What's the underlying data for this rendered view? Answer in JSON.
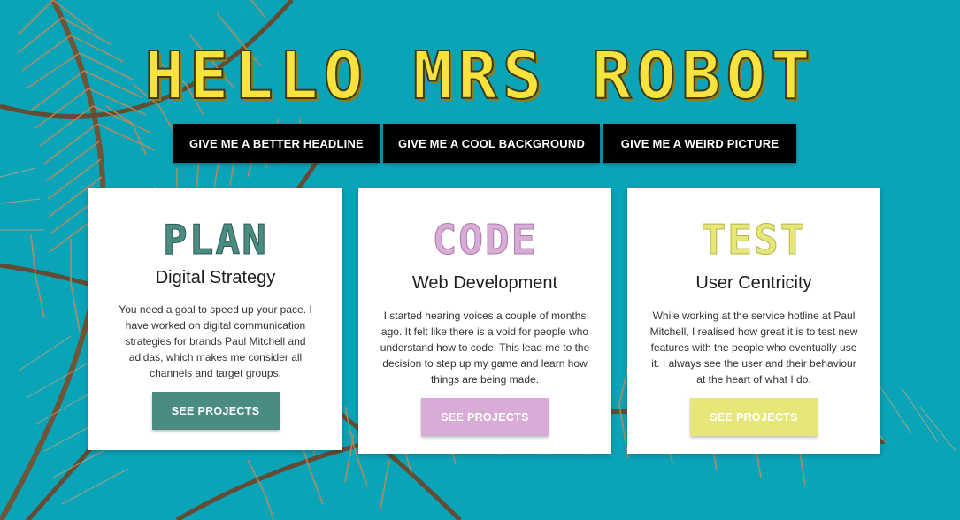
{
  "hero": {
    "title": "HELLO MRS ROBOT"
  },
  "actions": [
    {
      "label": "GIVE ME A BETTER HEADLINE"
    },
    {
      "label": "GIVE ME A COOL BACKGROUND"
    },
    {
      "label": "GIVE ME A WEIRD PICTURE"
    }
  ],
  "cards": [
    {
      "tag": "PLAN",
      "title": "Digital Strategy",
      "text": "You need a goal to speed up your pace. I have worked on digital communication strategies for brands Paul Mitchell and adidas, which makes me consider all channels and target groups.",
      "button": "SEE PROJECTS",
      "color": "#4a8c82",
      "tag_color": "#4a8c82"
    },
    {
      "tag": "CODE",
      "title": "Web Development",
      "text": "I started hearing voices a couple of months ago. It felt like there is a void for people who understand how to code. This lead me to the decision to step up my game and learn how things are being made.",
      "button": "SEE PROJECTS",
      "color": "#d9acd8",
      "tag_color": "#d9acd8"
    },
    {
      "tag": "TEST",
      "title": "User Centricity",
      "text": "While working at the service hotline at Paul Mitchell, I realised how great it is to test new features with the people who eventually use it. I always see the user and their behaviour at the heart of what I do.",
      "button": "SEE PROJECTS",
      "color": "#e6e679",
      "tag_color": "#e6e679"
    }
  ],
  "colors": {
    "sky": "#0aa4b9",
    "title": "#f7e23e"
  },
  "background": {
    "icon": "palm-leaves-image"
  }
}
